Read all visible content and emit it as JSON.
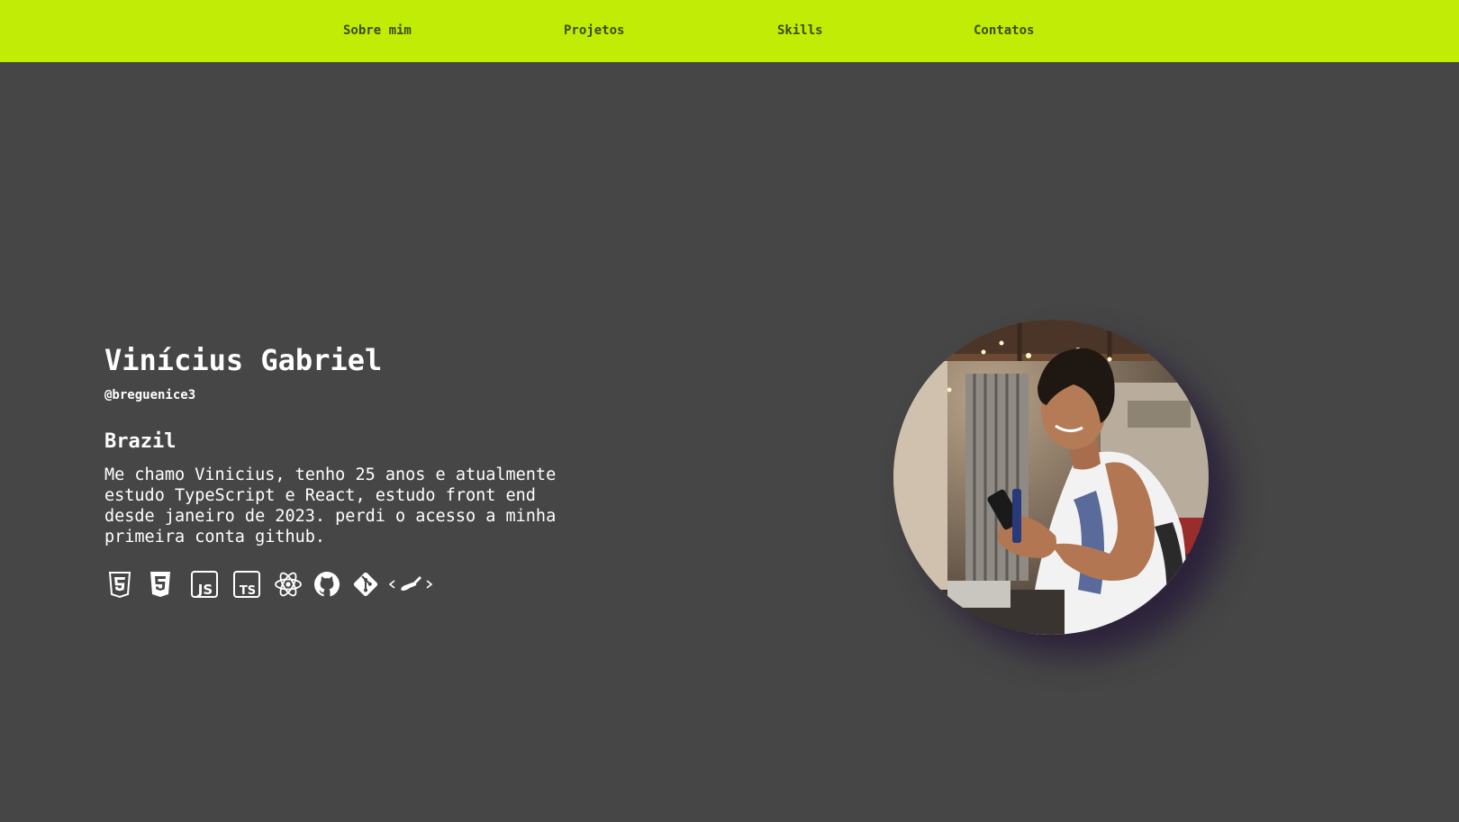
{
  "nav": {
    "items": [
      {
        "label": "Sobre mim"
      },
      {
        "label": "Projetos"
      },
      {
        "label": "Skills"
      },
      {
        "label": "Contatos"
      }
    ]
  },
  "profile": {
    "name": "Vinícius Gabriel",
    "handle": "@breguenice3",
    "country": "Brazil",
    "bio": "Me chamo Vinicius, tenho 25 anos e atualmente estudo TypeScript e React, estudo front end desde janeiro de 2023. perdi o acesso a minha primeira conta github."
  },
  "skills": {
    "icons": [
      "html5-icon",
      "css3-icon",
      "javascript-icon",
      "typescript-icon",
      "react-icon",
      "github-icon",
      "git-icon",
      "styled-components-icon"
    ]
  },
  "colors": {
    "nav_bg": "#c0ec06",
    "nav_text": "#3f4a14",
    "page_bg": "#464646",
    "text": "#ffffff",
    "photo_shadow": "#281c3a"
  }
}
